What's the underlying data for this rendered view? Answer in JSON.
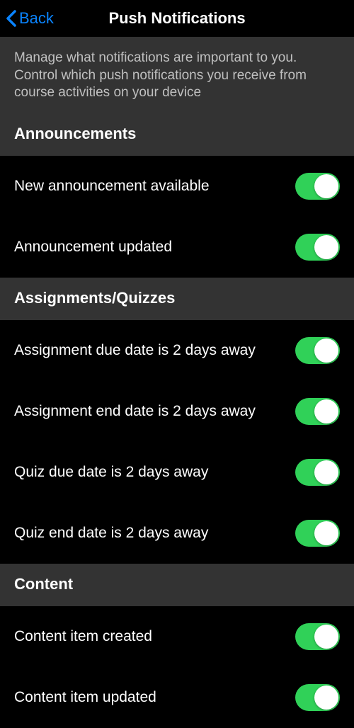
{
  "nav": {
    "back_label": "Back",
    "title": "Push Notifications"
  },
  "description": "Manage what notifications are important to you. Control which push notifications you receive from course activities on your device",
  "sections": [
    {
      "header": "Announcements",
      "rows": [
        {
          "label": "New announcement available",
          "on": true
        },
        {
          "label": "Announcement updated",
          "on": true
        }
      ]
    },
    {
      "header": "Assignments/Quizzes",
      "rows": [
        {
          "label": "Assignment due date is 2 days away",
          "on": true
        },
        {
          "label": "Assignment end date is 2 days away",
          "on": true
        },
        {
          "label": "Quiz due date is 2 days away",
          "on": true
        },
        {
          "label": "Quiz end date is 2 days away",
          "on": true
        }
      ]
    },
    {
      "header": "Content",
      "rows": [
        {
          "label": "Content item created",
          "on": true
        },
        {
          "label": "Content item updated",
          "on": true
        }
      ]
    }
  ]
}
